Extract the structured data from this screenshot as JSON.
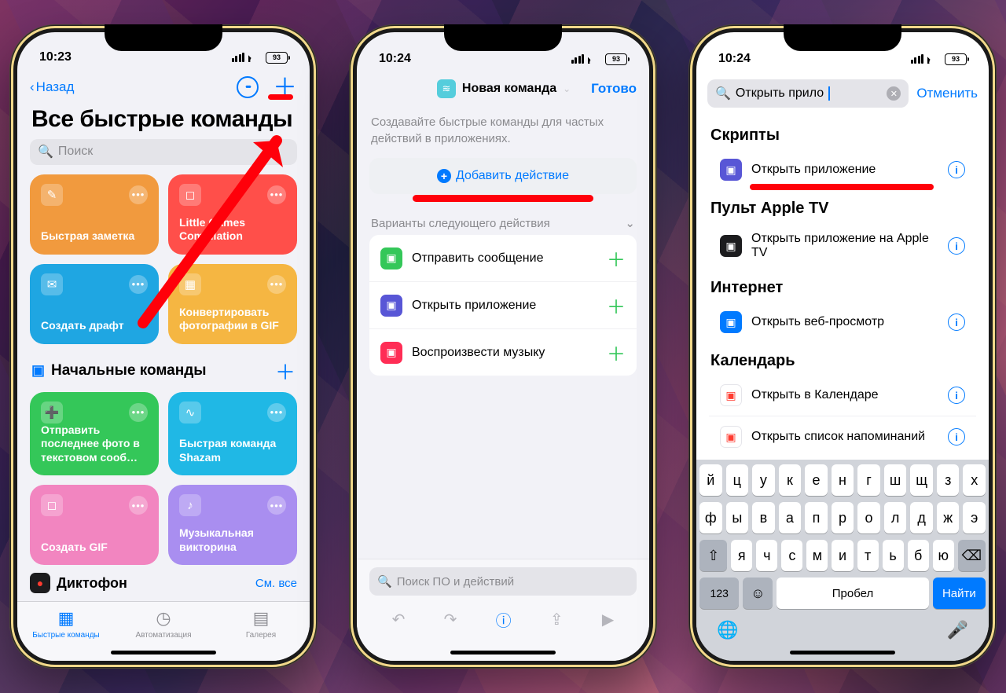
{
  "status": {
    "time1": "10:23",
    "time2": "10:24",
    "time3": "10:24",
    "battery": "93"
  },
  "s1": {
    "back": "Назад",
    "title": "Все быстрые команды",
    "search": "Поиск",
    "cards": [
      {
        "label": "Быстрая заметка",
        "color": "#f19a3e"
      },
      {
        "label": "Little Games Compilation",
        "color": "#ff4f4a"
      },
      {
        "label": "Создать драфт",
        "color": "#1fa6e2"
      },
      {
        "label": "Конвертировать фотографии в GIF",
        "color": "#f5b642"
      }
    ],
    "section": "Начальные команды",
    "cards2": [
      {
        "label": "Отправить последнее фото в текстовом сооб…",
        "color": "#34c759"
      },
      {
        "label": "Быстрая команда Shazam",
        "color": "#20b8e5"
      },
      {
        "label": "Создать GIF",
        "color": "#f285c0"
      },
      {
        "label": "Музыкальная викторина",
        "color": "#a98ef0"
      }
    ],
    "row": "Диктофон",
    "seeall": "См. все",
    "tabs": [
      "Быстрые команды",
      "Автоматизация",
      "Галерея"
    ]
  },
  "s2": {
    "title": "Новая команда",
    "done": "Готово",
    "hint": "Создавайте быстрые команды для частых действий в приложениях.",
    "add": "Добавить действие",
    "next": "Варианты следующего действия",
    "items": [
      {
        "label": "Отправить сообщение",
        "color": "#34c759"
      },
      {
        "label": "Открыть приложение",
        "color": "#5856d6"
      },
      {
        "label": "Воспроизвести музыку",
        "color": "#ff2d55"
      }
    ],
    "search": "Поиск ПО и действий"
  },
  "s3": {
    "query": "Открыть прило",
    "cancel": "Отменить",
    "groups": [
      {
        "h": "Скрипты",
        "items": [
          {
            "label": "Открыть приложение",
            "color": "#5856d6",
            "mark": true
          }
        ]
      },
      {
        "h": "Пульт Apple TV",
        "items": [
          {
            "label": "Открыть приложение на Apple TV",
            "color": "#1c1c1e"
          }
        ]
      },
      {
        "h": "Интернет",
        "items": [
          {
            "label": "Открыть веб-просмотр",
            "color": "#007aff"
          }
        ]
      },
      {
        "h": "Календарь",
        "items": [
          {
            "label": "Открыть в Календаре",
            "color": "#ffffff"
          },
          {
            "label": "Открыть список напоминаний",
            "color": "#ffffff"
          }
        ]
      }
    ],
    "kbd": {
      "r1": [
        "й",
        "ц",
        "у",
        "к",
        "е",
        "н",
        "г",
        "ш",
        "щ",
        "з",
        "х"
      ],
      "r2": [
        "ф",
        "ы",
        "в",
        "а",
        "п",
        "р",
        "о",
        "л",
        "д",
        "ж",
        "э"
      ],
      "r3": [
        "я",
        "ч",
        "с",
        "м",
        "и",
        "т",
        "ь",
        "б",
        "ю"
      ],
      "num": "123",
      "space": "Пробел",
      "find": "Найти"
    }
  }
}
